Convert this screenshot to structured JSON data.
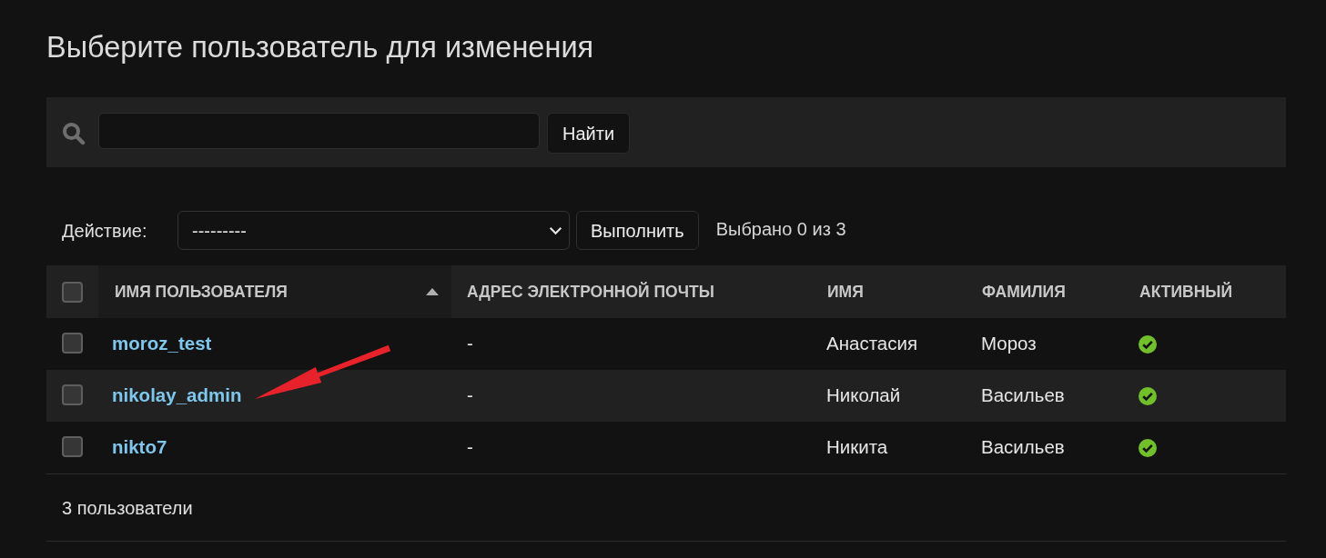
{
  "title": "Выберите пользователь для изменения",
  "search": {
    "button": "Найти"
  },
  "actions": {
    "label": "Действие:",
    "select_value": "---------",
    "button": "Выполнить",
    "selection_counter": "Выбрано 0 из 3"
  },
  "table": {
    "select_all_checked": false,
    "columns": [
      {
        "label": "ИМЯ ПОЛЬЗОВАТЕЛЯ",
        "sorted": true
      },
      {
        "label": "АДРЕС ЭЛЕКТРОННОЙ ПОЧТЫ",
        "sorted": false
      },
      {
        "label": "ИМЯ",
        "sorted": false
      },
      {
        "label": "ФАМИЛИЯ",
        "sorted": false
      },
      {
        "label": "АКТИВНЫЙ",
        "sorted": false
      }
    ],
    "rows": [
      {
        "checked": false,
        "username": "moroz_test",
        "email": "-",
        "first_name": "Анастасия",
        "last_name": "Мороз",
        "active": true,
        "pointed_at": false
      },
      {
        "checked": false,
        "username": "nikolay_admin",
        "email": "-",
        "first_name": "Николай",
        "last_name": "Васильев",
        "active": true,
        "pointed_at": true
      },
      {
        "checked": false,
        "username": "nikto7",
        "email": "-",
        "first_name": "Никита",
        "last_name": "Васильев",
        "active": true,
        "pointed_at": false
      }
    ]
  },
  "footer": "3 пользователи"
}
